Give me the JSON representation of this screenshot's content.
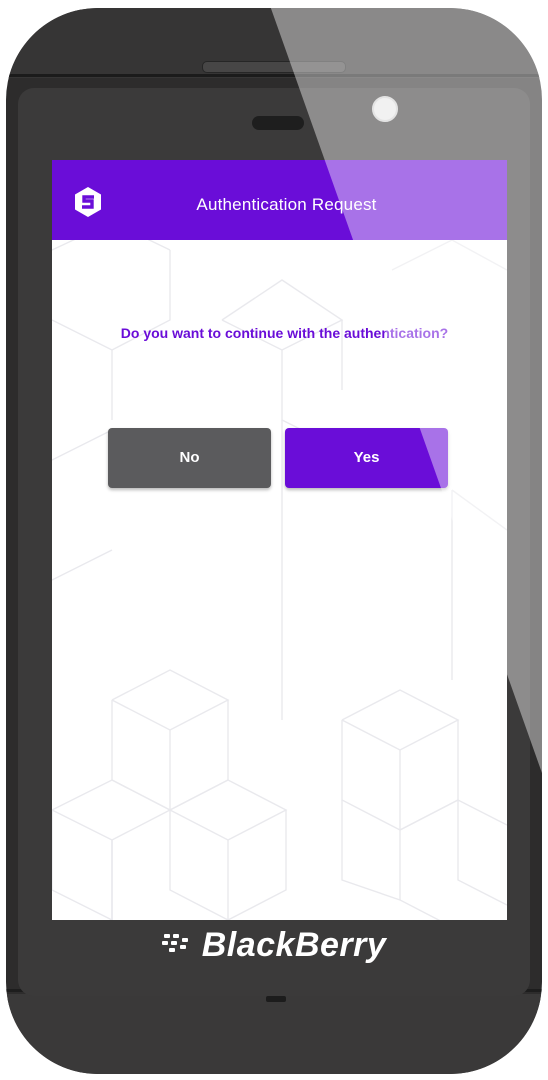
{
  "screen": {
    "header": {
      "title": "Authentication Request",
      "logo_icon": "shield-s-logo-icon"
    },
    "prompt": "Do you want to continue with the authentication?",
    "buttons": {
      "no_label": "No",
      "yes_label": "Yes"
    }
  },
  "device": {
    "brand": "BlackBerry",
    "brand_icon": "blackberry-logo-icon"
  },
  "colors": {
    "accent": "#6a0dd8",
    "no_button": "#5b5b5d",
    "background": "#ffffff",
    "device_body": "#2d2c2c"
  }
}
